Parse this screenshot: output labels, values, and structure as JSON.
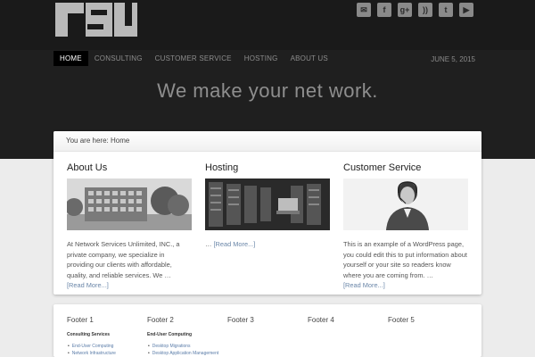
{
  "social": [
    "mail-icon",
    "facebook-icon",
    "google-plus-icon",
    "rss-icon",
    "twitter-icon",
    "youtube-icon"
  ],
  "social_glyphs": [
    "✉",
    "f",
    "g+",
    "))",
    "t",
    "▶"
  ],
  "nav": [
    {
      "label": "HOME",
      "active": true
    },
    {
      "label": "CONSULTING",
      "active": false
    },
    {
      "label": "CUSTOMER SERVICE",
      "active": false
    },
    {
      "label": "HOSTING",
      "active": false
    },
    {
      "label": "ABOUT US",
      "active": false
    }
  ],
  "date": "JUNE 5, 2015",
  "tagline": "We make your net work.",
  "breadcrumb": "You are here: Home",
  "columns": [
    {
      "title": "About Us",
      "text": "At Network Services Unlimited, INC., a private company, we specialize in providing our clients with affordable, quality, and reliable services. We …",
      "more": "[Read More...]"
    },
    {
      "title": "Hosting",
      "text": "…",
      "more": "[Read More...]"
    },
    {
      "title": "Customer Service",
      "text": "This is an example of a WordPress page, you could edit this to put information about yourself or your site so readers know where you are coming from. …",
      "more": "[Read More...]"
    }
  ],
  "footer": [
    {
      "title": "Footer 1",
      "sub": "Consulting Services",
      "items": [
        "End-User Computing",
        "Network Infrastructure"
      ]
    },
    {
      "title": "Footer 2",
      "sub": "End-User Computing",
      "items": [
        "Desktop Migrations",
        "Desktop Application Management"
      ]
    },
    {
      "title": "Footer 3"
    },
    {
      "title": "Footer 4"
    },
    {
      "title": "Footer 5"
    }
  ]
}
